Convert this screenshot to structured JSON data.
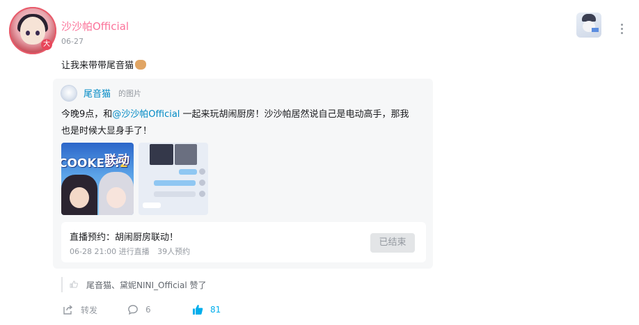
{
  "author": {
    "name": "沙沙帕Official",
    "date": "06-27",
    "badge": "大"
  },
  "post": {
    "text": "让我来带带尾音猫"
  },
  "repost": {
    "name": "尾音猫",
    "type": "的图片",
    "text_before": "今晚9点，和",
    "mention": "@沙沙帕Official",
    "text_after": " 一起来玩胡闹厨房！沙沙帕居然说自己是电动高手，那我也是时候大显身手了！",
    "image1": {
      "logo": "COOKED!",
      "logo_num": "2",
      "cn": "联动"
    },
    "live": {
      "title": "直播预约：胡闹厨房联动！",
      "time": "06-28 21:00 进行直播",
      "reservations": "39人预约",
      "status_button": "已结束"
    }
  },
  "likes": {
    "text": "尾音猫、黛妮NINI_Official 赞了"
  },
  "actions": {
    "share_label": "转发",
    "comment_count": "6",
    "like_count": "81"
  },
  "colors": {
    "username": "#fb7299",
    "link": "#008ac5",
    "like_active": "#00aeec",
    "muted": "#9499a0"
  }
}
